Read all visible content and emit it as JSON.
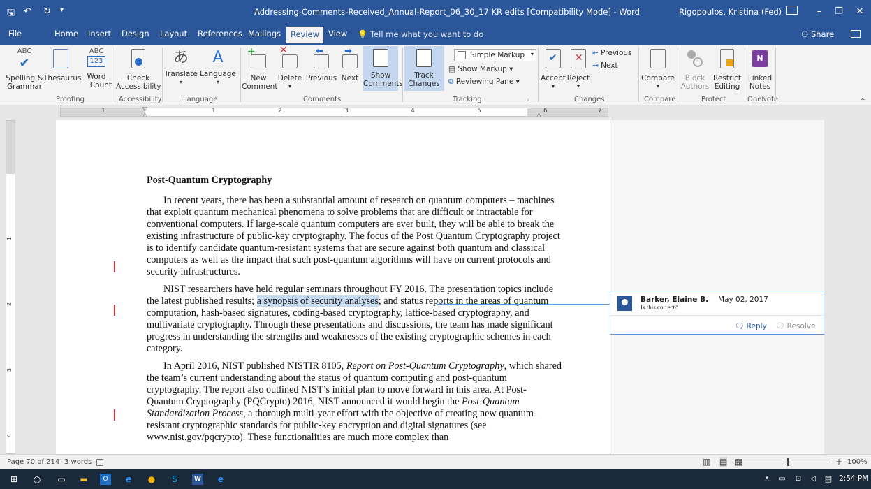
{
  "window": {
    "title": "Addressing-Comments-Received_Annual-Report_06_30_17 KR edits [Compatibility Mode]  -  Word",
    "user": "Rigopoulos, Kristina (Fed)"
  },
  "tabs": [
    "File",
    "Home",
    "Insert",
    "Design",
    "Layout",
    "References",
    "Mailings",
    "Review",
    "View"
  ],
  "active_tab": "Review",
  "tellme": "Tell me what you want to do",
  "share": "Share",
  "ribbon": {
    "spelling": [
      "Spelling &",
      "Grammar"
    ],
    "thesaurus": "Thesaurus",
    "wordcount": [
      "Word",
      "Count"
    ],
    "abc_top": "ABC",
    "abc_num": "123",
    "check_access": [
      "Check",
      "Accessibility"
    ],
    "translate": "Translate",
    "language": "Language",
    "new_comment": [
      "New",
      "Comment"
    ],
    "delete": "Delete",
    "previous": "Previous",
    "next": "Next",
    "show_comments": [
      "Show",
      "Comments"
    ],
    "track_changes": [
      "Track",
      "Changes"
    ],
    "simple_markup": "Simple Markup",
    "show_markup": "Show Markup",
    "reviewing_pane": "Reviewing Pane",
    "accept": "Accept",
    "reject": "Reject",
    "chg_previous": "Previous",
    "chg_next": "Next",
    "compare": "Compare",
    "block_authors": [
      "Block",
      "Authors"
    ],
    "restrict_editing": [
      "Restrict",
      "Editing"
    ],
    "linked_notes": [
      "Linked",
      "Notes"
    ],
    "groups": [
      "Proofing",
      "Accessibility",
      "Language",
      "Comments",
      "Tracking",
      "Changes",
      "Compare",
      "Protect",
      "OneNote"
    ]
  },
  "ruler_numbers": [
    "1",
    "1",
    "2",
    "3",
    "4",
    "5",
    "6",
    "7"
  ],
  "vruler_numbers": [
    "1",
    "2",
    "3",
    "4"
  ],
  "document": {
    "heading": "Post-Quantum Cryptography",
    "p1": "In recent years, there has been a substantial amount of research on quantum computers – machines that exploit quantum mechanical phenomena to solve problems that are difficult or intractable for conventional computers. If large-scale quantum computers are ever built, they will be able to break the existing infrastructure of public-key cryptography. The focus of the Post Quantum Cryptography project is to identify candidate quantum-resistant systems that are secure against both quantum and classical computers as well as the impact that such post-quantum algorithms will have on current protocols and security infrastructures.",
    "p2_a": "NIST researchers have held regular seminars throughout FY 2016. The presentation topics include the latest published results; ",
    "p2_hl": "a synopsis of security analyses",
    "p2_b": "; and status reports in the areas of quantum computation, hash-based signatures, coding-based cryptography, lattice-based cryptography, and multivariate cryptography. Through these presentations and discussions, the team has made significant progress in understanding the strengths and weaknesses of the existing cryptographic schemes in each category.",
    "p3_a": "In April 2016, NIST published NISTIR 8105, ",
    "p3_i1": "Report on Post-Quantum Cryptography",
    "p3_b": ", which shared the team’s current understanding about the status of quantum computing and post-quantum cryptography.  The report also outlined NIST’s initial plan to move forward in this area. At Post-Quantum Cryptography (PQCrypto) 2016, NIST announced it would begin the ",
    "p3_i2": "Post-Quantum Standardization Process",
    "p3_c": ", a thorough multi-year effort with the objective of creating new quantum-resistant cryptographic standards for public-key encryption and digital signatures (see www.nist.gov/pqcrypto).  These functionalities are much more complex than"
  },
  "comment": {
    "author": "Barker, Elaine B.",
    "date": "May 02, 2017",
    "text": "Is this correct?",
    "reply": "Reply",
    "resolve": "Resolve"
  },
  "status": {
    "page": "Page 70 of 214",
    "words": "3 words",
    "zoom": "100%"
  },
  "taskbar": {
    "time": "2:54 PM"
  },
  "colors": {
    "brand": "#2b579a",
    "comment_border": "#5b9bd5",
    "change_bar": "#d13438",
    "highlight": "#c7dcf3"
  }
}
